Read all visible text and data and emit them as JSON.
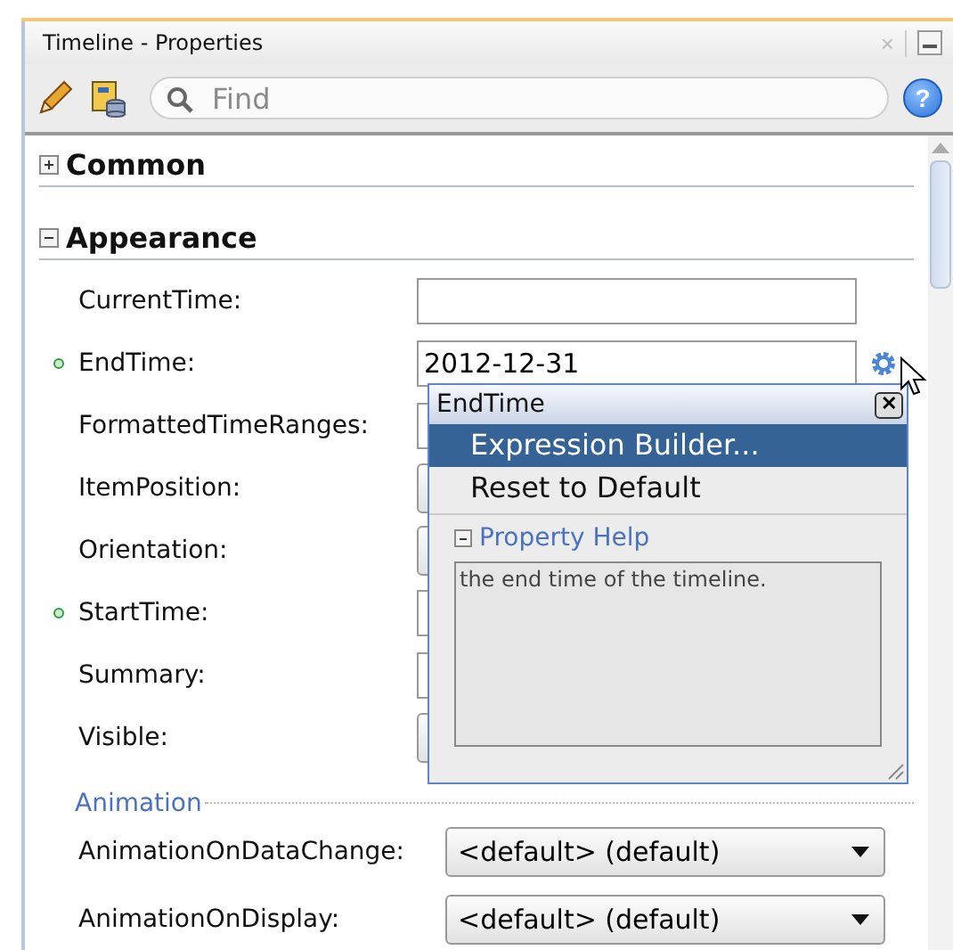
{
  "window": {
    "title": "Timeline - Properties",
    "close": "×"
  },
  "toolbar": {
    "search": {
      "placeholder": "Find"
    },
    "help": "?"
  },
  "sections": [
    {
      "title": "Common",
      "expanded": false
    },
    {
      "title": "Appearance",
      "expanded": true,
      "properties": [
        {
          "label": "CurrentTime:",
          "kind": "text",
          "set": false
        },
        {
          "label": "EndTime:",
          "kind": "text",
          "set": true,
          "value": "2012-12-31",
          "gear": true
        },
        {
          "label": "FormattedTimeRanges:",
          "kind": "text",
          "set": false
        },
        {
          "label": "ItemPosition:",
          "kind": "select",
          "set": false
        },
        {
          "label": "Orientation:",
          "kind": "select",
          "set": false
        },
        {
          "label": "StartTime:",
          "kind": "text",
          "set": true
        },
        {
          "label": "Summary:",
          "kind": "text",
          "set": false
        },
        {
          "label": "Visible:",
          "kind": "select",
          "set": false
        }
      ]
    }
  ],
  "subsection": {
    "title": "Animation",
    "properties": [
      {
        "label": "AnimationOnDataChange:",
        "kind": "select",
        "set": false,
        "value": "<default> (default)"
      },
      {
        "label": "AnimationOnDisplay:",
        "kind": "select",
        "set": false,
        "value": "<default> (default)"
      }
    ]
  },
  "popup": {
    "title": "EndTime",
    "close": "✕",
    "menu": [
      {
        "label": "Expression Builder...",
        "selected": true
      },
      {
        "label": "Reset to Default",
        "selected": false
      }
    ],
    "help": {
      "title": "Property Help",
      "expanded": true,
      "text": "the end time of the timeline."
    }
  }
}
